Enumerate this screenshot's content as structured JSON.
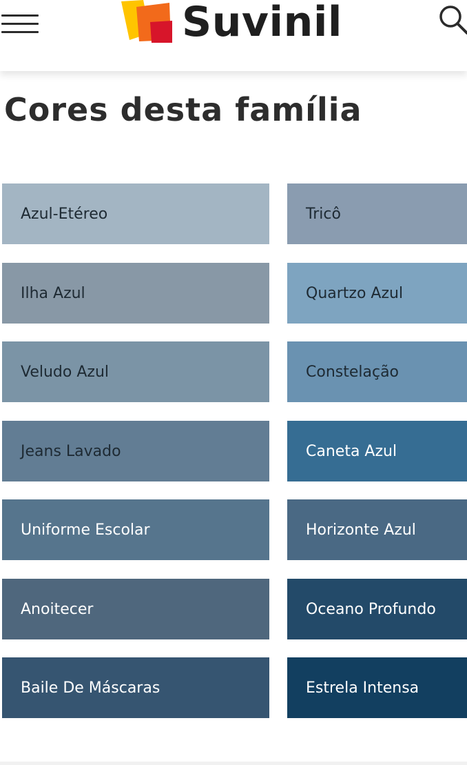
{
  "header": {
    "brand": "Suvinil",
    "menu_icon": "hamburger-menu-icon",
    "search_icon": "search-icon"
  },
  "section": {
    "title": "Cores desta família"
  },
  "colors": {
    "left": [
      {
        "name": "Azul-Etéreo",
        "hex": "#a3b5c3",
        "text": "dark"
      },
      {
        "name": "Ilha Azul",
        "hex": "#8898a6",
        "text": "dark"
      },
      {
        "name": "Veludo Azul",
        "hex": "#7b94a6",
        "text": "dark"
      },
      {
        "name": "Jeans Lavado",
        "hex": "#627d94",
        "text": "dark"
      },
      {
        "name": "Uniforme Escolar",
        "hex": "#56758d",
        "text": "light"
      },
      {
        "name": "Anoitecer",
        "hex": "#4f677d",
        "text": "light"
      },
      {
        "name": "Baile De Máscaras",
        "hex": "#365571",
        "text": "light"
      }
    ],
    "right": [
      {
        "name": "Tricô",
        "hex": "#8a9cb0",
        "text": "dark"
      },
      {
        "name": "Quartzo Azul",
        "hex": "#7ea4c0",
        "text": "dark"
      },
      {
        "name": "Constelação",
        "hex": "#6a92b1",
        "text": "dark"
      },
      {
        "name": "Caneta Azul",
        "hex": "#366d93",
        "text": "light"
      },
      {
        "name": "Horizonte Azul",
        "hex": "#4a6984",
        "text": "light"
      },
      {
        "name": "Oceano Profundo",
        "hex": "#234a69",
        "text": "light"
      },
      {
        "name": "Estrela Intensa",
        "hex": "#123f60",
        "text": "light"
      }
    ]
  },
  "accent": {
    "logo_yellow": "#ffc400",
    "logo_orange": "#f26a1b",
    "logo_red": "#d7152a"
  }
}
